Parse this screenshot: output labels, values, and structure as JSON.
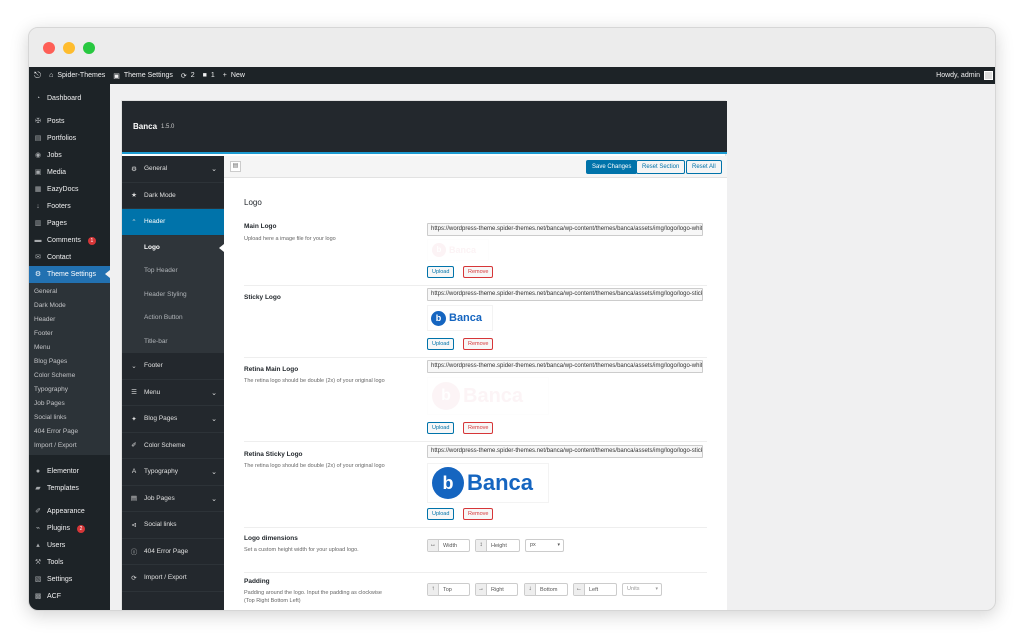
{
  "adminbar": {
    "site": "Spider-Themes",
    "theme_settings": "Theme Settings",
    "updates": "2",
    "comments": "1",
    "new": "New",
    "howdy": "Howdy, admin"
  },
  "wp_menu": {
    "items_top": [
      {
        "label": "Dashboard",
        "icon": "dashboard-icon"
      }
    ],
    "items_content": [
      {
        "label": "Posts",
        "icon": "pin-icon"
      },
      {
        "label": "Portfolios",
        "icon": "portfolio-icon"
      },
      {
        "label": "Jobs",
        "icon": "jobs-icon"
      },
      {
        "label": "Media",
        "icon": "media-icon"
      },
      {
        "label": "EazyDocs",
        "icon": "docs-icon"
      },
      {
        "label": "Footers",
        "icon": "arrow-down-icon"
      },
      {
        "label": "Pages",
        "icon": "pages-icon"
      },
      {
        "label": "Comments",
        "icon": "comments-icon",
        "badge": "1"
      },
      {
        "label": "Contact",
        "icon": "mail-icon"
      }
    ],
    "active": {
      "label": "Theme Settings",
      "icon": "gear-icon"
    },
    "submenu": [
      "General",
      "Dark Mode",
      "Header",
      "Footer",
      "Menu",
      "Blog Pages",
      "Color Scheme",
      "Typography",
      "Job Pages",
      "Social links",
      "404 Error Page",
      "Import / Export"
    ],
    "items_bottom": [
      {
        "label": "Elementor",
        "icon": "elementor-icon"
      },
      {
        "label": "Templates",
        "icon": "folder-icon"
      }
    ],
    "items_tools": [
      {
        "label": "Appearance",
        "icon": "brush-icon"
      },
      {
        "label": "Plugins",
        "icon": "plug-icon",
        "badge": "2"
      },
      {
        "label": "Users",
        "icon": "user-icon"
      },
      {
        "label": "Tools",
        "icon": "wrench-icon"
      },
      {
        "label": "Settings",
        "icon": "settings-icon"
      },
      {
        "label": "ACF",
        "icon": "acf-icon"
      }
    ]
  },
  "panel": {
    "title": "Banca",
    "version": "1.5.0"
  },
  "sections": {
    "general": "General",
    "dark_mode": "Dark Mode",
    "header": "Header",
    "header_sub": [
      "Logo",
      "Top Header",
      "Header Styling",
      "Action Button",
      "Title-bar"
    ],
    "footer": "Footer",
    "menu": "Menu",
    "blog_pages": "Blog Pages",
    "color_scheme": "Color Scheme",
    "typography": "Typography",
    "job_pages": "Job Pages",
    "social_links": "Social links",
    "error_page": "404 Error Page",
    "import_export": "Import / Export"
  },
  "toolbar": {
    "save": "Save Changes",
    "reset_section": "Reset Section",
    "reset_all": "Reset All"
  },
  "main": {
    "section_title": "Logo",
    "fields": {
      "main_logo": {
        "label": "Main Logo",
        "desc": "Upload here a image file for your logo",
        "url": "https://wordpress-theme.spider-themes.net/banca/wp-content/themes/banca/assets/img/logo/logo-white.svg"
      },
      "sticky_logo": {
        "label": "Sticky Logo",
        "url": "https://wordpress-theme.spider-themes.net/banca/wp-content/themes/banca/assets/img/logo/logo-sticky.svg"
      },
      "retina_main": {
        "label": "Retina Main Logo",
        "desc": "The retina logo should be double (2x) of your original logo",
        "url": "https://wordpress-theme.spider-themes.net/banca/wp-content/themes/banca/assets/img/logo/logo-white.svg"
      },
      "retina_sticky": {
        "label": "Retina Sticky Logo",
        "desc": "The retina logo should be double (2x) of your original logo",
        "url": "https://wordpress-theme.spider-themes.net/banca/wp-content/themes/banca/assets/img/logo/logo-sticky.svg"
      },
      "dimensions": {
        "label": "Logo dimensions",
        "desc": "Set a custom height width for your upload logo.",
        "width": "Width",
        "height": "Height",
        "unit": "px"
      },
      "padding": {
        "label": "Padding",
        "desc": "Padding around the logo. Input the padding as clockwise (Top Right Bottom Left)",
        "top": "Top",
        "right": "Right",
        "bottom": "Bottom",
        "left": "Left",
        "units": "Units"
      }
    },
    "upload": "Upload",
    "remove": "Remove",
    "logo_letter": "b",
    "logo_text": "Banca"
  },
  "colors": {
    "accent": "#0073aa",
    "admin_bg": "#1d2327",
    "logo_blue": "#1565c0"
  }
}
